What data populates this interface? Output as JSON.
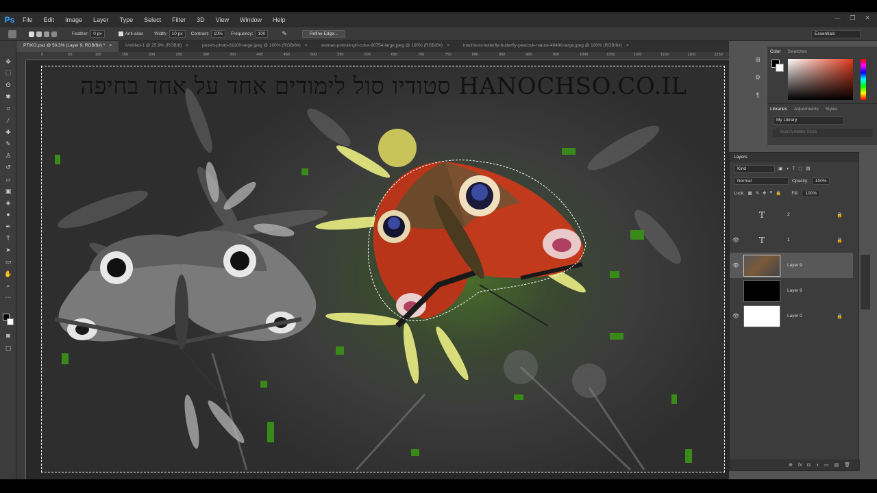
{
  "app": {
    "logo": "Ps"
  },
  "menu": [
    "File",
    "Edit",
    "Image",
    "Layer",
    "Type",
    "Select",
    "Filter",
    "3D",
    "View",
    "Window",
    "Help"
  ],
  "window_controls": [
    "—",
    "❐",
    "✕"
  ],
  "options": {
    "feather_label": "Feather:",
    "feather_value": "0 px",
    "antialias_label": "Anti-alias",
    "width_label": "Width:",
    "width_value": "10 px",
    "contrast_label": "Contrast:",
    "contrast_value": "10%",
    "frequency_label": "Frequency:",
    "frequency_value": "100",
    "refine_label": "Refine Edge...",
    "workspace": "Essentials"
  },
  "tabs": [
    {
      "label": "PTIKO.psd @ 50.3% (Layer 9, RGB/8#) *"
    },
    {
      "label": "Untitled-1 @ 25.9% (RGB/8)"
    },
    {
      "label": "pexels-photo-61100-large.jpeg @ 100% (RGB/8#)"
    },
    {
      "label": "woman-portrait-girl-color-90754-large.jpeg @ 100% (RGB/8#)"
    },
    {
      "label": "inachis-io-butterfly-butterfly-peacock-nature-46498-large.jpeg @ 100% (RGB/8#)"
    }
  ],
  "tab_close": "×",
  "ruler": [
    "0",
    "50",
    "100",
    "150",
    "200",
    "250",
    "300",
    "350",
    "400",
    "450",
    "500",
    "550",
    "600",
    "650",
    "700",
    "750",
    "800",
    "850",
    "900",
    "950",
    "1000",
    "1050",
    "1100",
    "1150",
    "1200",
    "1250"
  ],
  "canvas": {
    "title": "סטודיו סול לימודים אחד על אחד בחיפה HANOCHSO.CO.IL"
  },
  "color_panel": {
    "tab_color": "Color",
    "tab_swatches": "Swatches"
  },
  "libraries": {
    "tab_libraries": "Libraries",
    "tab_adjustments": "Adjustments",
    "tab_styles": "Styles",
    "library": "My Library",
    "search_placeholder": "Search Adobe Stock"
  },
  "layers": {
    "title": "Layers",
    "filter": "Kind",
    "blend": "Normal",
    "opacity_label": "Opacity:",
    "opacity_value": "100%",
    "lock_label": "Lock:",
    "fill_label": "Fill:",
    "fill_value": "100%",
    "items": [
      {
        "name": "2",
        "thumb": "T",
        "visible": false
      },
      {
        "name": "1",
        "thumb": "T",
        "visible": true
      },
      {
        "name": "Layer 9",
        "thumb": "",
        "visible": true
      },
      {
        "name": "Layer 8",
        "thumb": "",
        "visible": false
      },
      {
        "name": "Layer 0",
        "thumb": "",
        "visible": true
      }
    ],
    "footer": [
      "⊕",
      "fx",
      "◘",
      "◑",
      "▭",
      "▤",
      "🗑"
    ]
  }
}
